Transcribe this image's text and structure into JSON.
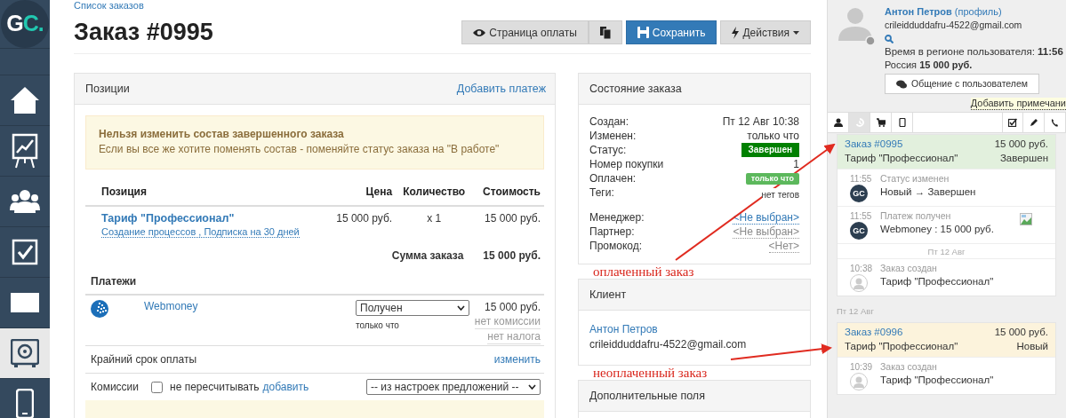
{
  "sidebar": {
    "logo": [
      "G",
      "C."
    ],
    "items": [
      {
        "kind": "home",
        "selected": false
      },
      {
        "kind": "chart",
        "selected": false
      },
      {
        "kind": "people",
        "selected": false
      },
      {
        "kind": "tasks",
        "selected": false
      },
      {
        "kind": "mail",
        "selected": false
      },
      {
        "kind": "safe",
        "selected": true
      },
      {
        "kind": "phone",
        "selected": false
      }
    ]
  },
  "breadcrumb": "Список заказов",
  "title": "Заказ #0995",
  "toolbar": [
    {
      "kind": "eye",
      "label": "Страница оплаты"
    },
    {
      "kind": "copy"
    },
    {
      "kind": "save",
      "label": "Сохранить"
    },
    {
      "kind": "actions",
      "label": "Действия"
    }
  ],
  "positions": {
    "title": "Позиции",
    "add_payment": "Добавить платеж",
    "alert": {
      "title": "Нельзя изменить состав завершенного заказа",
      "text": "Если вы все же хотите поменять состав - поменяйте статус заказа на \"В работе\""
    },
    "columns": [
      "Позиция",
      "Цена",
      "Количество",
      "Стоимость"
    ],
    "rows": [
      {
        "name": "Тариф \"Профессионал\"",
        "details": "Создание процессов , Подписка на 30 дней",
        "price": "15 000 руб.",
        "quantity": "x 1",
        "cost": "15 000 руб."
      }
    ],
    "total": {
      "label": "Сумма заказа",
      "value": "15 000 руб."
    },
    "payments_title": "Платежи",
    "payments": [
      {
        "method": "Webmoney",
        "status": "Получен",
        "time": "только что",
        "amount": "15 000 руб.",
        "commission": "нет комиссии",
        "tax": "нет налога"
      }
    ],
    "deadline": {
      "label": "Крайний срок оплаты",
      "link": "изменить"
    },
    "commissions": {
      "label": "Комиссии",
      "checkbox_label": "не пересчитывать",
      "checked": false,
      "link": "добавить",
      "select": "-- из настроек предложений --"
    }
  },
  "order_state": {
    "title": "Состояние заказа",
    "fields": [
      {
        "label": "Создан:",
        "value": "Пт 12 Авг 10:38",
        "kind": "text"
      },
      {
        "label": "Изменен:",
        "value": "только что",
        "kind": "text"
      },
      {
        "label": "Статус:",
        "value": "Завершен",
        "kind": "status"
      },
      {
        "label": "Номер покупки",
        "value": "1",
        "kind": "text"
      },
      {
        "label": "Оплачен:",
        "value": "только что",
        "kind": "paid"
      },
      {
        "label": "Теги:",
        "value": "нет тегов",
        "kind": "small"
      },
      {
        "label": "Менеджер:",
        "value": "<Не выбран>",
        "kind": "link"
      },
      {
        "label": "Партнер:",
        "value": "<Не выбран>",
        "kind": "muted"
      },
      {
        "label": "Промокод:",
        "value": "<Нет>",
        "kind": "muted"
      }
    ]
  },
  "client": {
    "title": "Клиент",
    "name": "Антон Петров",
    "email": "crileidduddafru-4522@gmail.com"
  },
  "extra_fields": {
    "title": "Дополнительные поля"
  },
  "annotations": [
    {
      "text": "оплаченный заказ"
    },
    {
      "text": "неоплаченный заказ"
    }
  ],
  "user_panel": {
    "name": "Антон Петров",
    "profile_link": "(профиль)",
    "email": "crileidduddafru-4522@gmail.com",
    "time_label": "Время в регионе пользователя:",
    "time": "11:56",
    "country": "Россия",
    "total": "15 000 руб.",
    "chat_button": "Общение с пользователем",
    "note_link": "Добавить примечани",
    "tabs": [
      {
        "kind": "person",
        "selected": false
      },
      {
        "kind": "history",
        "selected": true
      },
      {
        "kind": "cart",
        "selected": false
      },
      {
        "kind": "tablet",
        "selected": false
      },
      {
        "kind": "checkbox",
        "selected": false
      },
      {
        "kind": "pencil",
        "selected": false
      },
      {
        "kind": "phone",
        "selected": false
      }
    ],
    "feed": [
      {
        "kind": "order",
        "title": "Заказ #0995",
        "amount": "15 000 руб.",
        "product": "Тариф \"Профессионал\"",
        "status": "Завершен",
        "paid": true,
        "events": [
          {
            "kind": "system_event",
            "time": "11:55",
            "title": "Статус изменен",
            "text": "Новый → Завершен",
            "avatar_text": "GC"
          },
          {
            "kind": "system_event",
            "time": "11:55",
            "title": "Платеж получен",
            "text": "Webmoney : 15 000 руб.",
            "avatar_text": "GC",
            "image": true
          },
          {
            "kind": "date",
            "text": "Пт 12 Авг"
          },
          {
            "kind": "user_event",
            "time": "10:38",
            "title": "Заказ создан",
            "text": "Тариф \"Профессионал\""
          }
        ]
      },
      {
        "kind": "date",
        "text": "Пт 12 Авг"
      },
      {
        "kind": "order",
        "title": "Заказ #0996",
        "amount": "15 000 руб.",
        "product": "Тариф \"Профессионал\"",
        "status": "Новый",
        "paid": false,
        "events": [
          {
            "kind": "user_event",
            "time": "10:39",
            "title": "Заказ создан",
            "text": "Тариф \"Профессионал\""
          }
        ]
      }
    ]
  }
}
